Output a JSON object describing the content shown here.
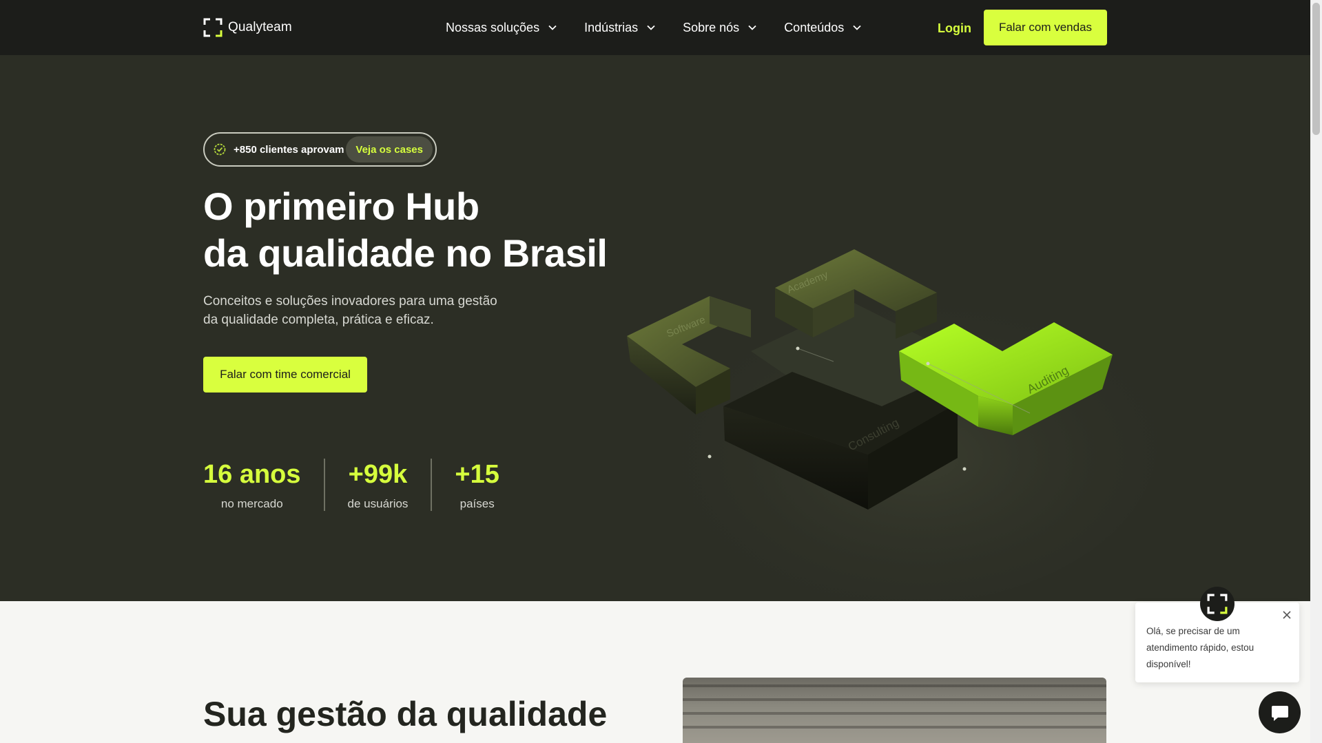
{
  "nav": {
    "logo_text": "Qualyteam",
    "menu": [
      {
        "label": "Nossas soluções"
      },
      {
        "label": "Indústrias"
      },
      {
        "label": "Sobre nós"
      },
      {
        "label": "Conteúdos"
      }
    ],
    "login_label": "Login",
    "cta_label": "Falar com vendas"
  },
  "hero": {
    "badge_text": "+850 clientes aprovam",
    "badge_link": "Veja os cases",
    "title_line1": "O primeiro Hub",
    "title_line2": "da qualidade no Brasil",
    "subtitle_line1": "Conceitos e soluções inovadores para uma gestão",
    "subtitle_line2": "da qualidade completa, prática e eficaz.",
    "cta_label": "Falar com time comercial",
    "stats": [
      {
        "value": "16 anos",
        "label": "no mercado"
      },
      {
        "value": "+99k",
        "label": "de usuários"
      },
      {
        "value": "+15",
        "label": "países"
      }
    ],
    "illustration_labels": [
      "Software",
      "Academy",
      "Auditing",
      "Consulting"
    ]
  },
  "section2": {
    "title": "Sua gestão da qualidade"
  },
  "chat": {
    "message": "Olá, se precisar de um atendimento rápido, estou disponível!"
  },
  "colors": {
    "accent": "#d9ff3e",
    "nav_bg": "#1c1d1a",
    "hero_bg": "#2c2e25"
  }
}
